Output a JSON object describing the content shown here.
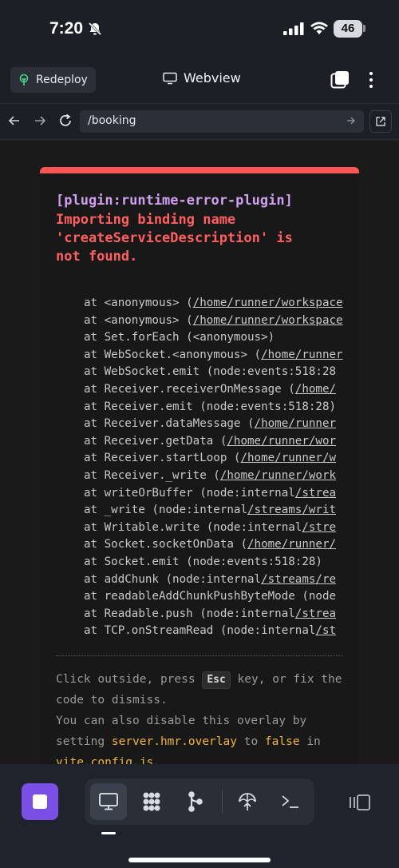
{
  "status": {
    "time": "7:20",
    "battery": "46"
  },
  "header": {
    "redeploy_label": "Redeploy",
    "title": "Webview"
  },
  "urlbar": {
    "url": "/booking"
  },
  "error": {
    "plugin": "[plugin:runtime-error-plugin]",
    "message": "Importing binding name\n'createServiceDescription' is\nnot found.",
    "stack": [
      {
        "pre": "at <anonymous> (",
        "link": "/home/runner/workspace",
        "post": ""
      },
      {
        "pre": "at <anonymous> (",
        "link": "/home/runner/workspace",
        "post": ""
      },
      {
        "pre": "at Set.forEach (<anonymous>)",
        "link": "",
        "post": ""
      },
      {
        "pre": "at WebSocket.<anonymous> (",
        "link": "/home/runner",
        "post": ""
      },
      {
        "pre": "at WebSocket.emit (node:events:518:28",
        "link": "",
        "post": ""
      },
      {
        "pre": "at Receiver.receiverOnMessage (",
        "link": "/home/",
        "post": ""
      },
      {
        "pre": "at Receiver.emit (node:events:518:28)",
        "link": "",
        "post": ""
      },
      {
        "pre": "at Receiver.dataMessage (",
        "link": "/home/runner",
        "post": ""
      },
      {
        "pre": "at Receiver.getData (",
        "link": "/home/runner/wor",
        "post": ""
      },
      {
        "pre": "at Receiver.startLoop (",
        "link": "/home/runner/w",
        "post": ""
      },
      {
        "pre": "at Receiver._write (",
        "link": "/home/runner/work",
        "post": ""
      },
      {
        "pre": "at writeOrBuffer (node:internal",
        "link": "/strea",
        "post": ""
      },
      {
        "pre": "at _write (node:internal",
        "link": "/streams/writ",
        "post": ""
      },
      {
        "pre": "at Writable.write (node:internal",
        "link": "/stre",
        "post": ""
      },
      {
        "pre": "at Socket.socketOnData (",
        "link": "/home/runner/",
        "post": ""
      },
      {
        "pre": "at Socket.emit (node:events:518:28)",
        "link": "",
        "post": ""
      },
      {
        "pre": "at addChunk (node:internal",
        "link": "/streams/re",
        "post": ""
      },
      {
        "pre": "at readableAddChunkPushByteMode (node",
        "link": "",
        "post": ""
      },
      {
        "pre": "at Readable.push (node:internal",
        "link": "/strea",
        "post": ""
      },
      {
        "pre": "at TCP.onStreamRead (node:internal",
        "link": "/st",
        "post": ""
      }
    ],
    "tip": {
      "t1": "Click outside, press ",
      "key": "Esc",
      "t2": " key, or fix the code to dismiss.",
      "t3": "You can also disable this overlay by setting ",
      "code1": "server.hmr.overlay",
      "t4": " to ",
      "code2": "false",
      "t5": " in ",
      "code3": "vite.config.js",
      "t6": "."
    }
  },
  "icons": {
    "bell_slash": "bell-slash-icon",
    "signal": "cellular-signal-icon",
    "wifi": "wifi-icon",
    "sprout": "sprout-icon",
    "monitor": "monitor-icon",
    "tabs": "tabs-icon",
    "kebab": "more-vertical-icon",
    "back": "arrow-left-icon",
    "forward": "arrow-right-icon",
    "reload": "reload-icon",
    "go": "arrow-right-icon",
    "external": "external-link-icon",
    "stop": "stop-icon",
    "preview": "monitor-icon",
    "workflows": "workflows-icon",
    "git": "git-branch-icon",
    "deploy": "deployments-icon",
    "shell": "terminal-icon",
    "panels": "panels-icon"
  },
  "colors": {
    "accent": "#7a4fe4",
    "error_bar": "#ff5555",
    "error_text": "#ff5f5f",
    "plugin_text": "#cfa0f0",
    "highlight": "#f2b53b"
  }
}
